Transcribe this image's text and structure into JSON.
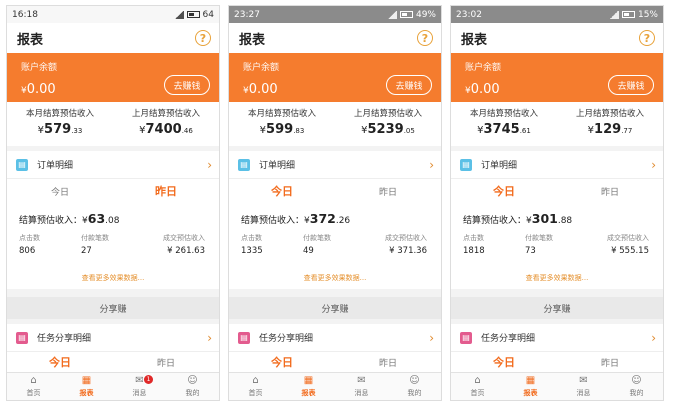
{
  "colors": {
    "accent": "#f57c2e",
    "active_tab": "#f26b1d",
    "help_icon": "#e8a23a"
  },
  "phones": [
    {
      "status": {
        "time": "16:18",
        "right": "64"
      },
      "title": "报表",
      "balance": {
        "label": "账户余额",
        "currency": "¥",
        "amount": "0.00",
        "button": "去赚钱"
      },
      "monthly": [
        {
          "label": "本月结算预估收入",
          "currency": "¥",
          "int": "579",
          "dec": ".33"
        },
        {
          "label": "上月结算预估收入",
          "currency": "¥",
          "int": "7400",
          "dec": ".46"
        }
      ],
      "orders_link": "订单明细",
      "tabs": [
        "今日",
        "昨日"
      ],
      "summary": {
        "label": "结算预估收入：",
        "currency": "¥",
        "int": "63",
        "dec": ".08"
      },
      "stats": [
        {
          "label": "点击数",
          "value": "806"
        },
        {
          "label": "付款笔数",
          "value": "27"
        },
        {
          "label": "成交预估收入",
          "value": "¥ 261.63"
        }
      ],
      "more": "查看更多效果数据...",
      "share_bar": "分享赚",
      "task_link": "任务分享明细",
      "tabs2": [
        "今日",
        "昨日"
      ],
      "nav": [
        {
          "label": "首页",
          "icon": "home-icon"
        },
        {
          "label": "报表",
          "icon": "report-icon"
        },
        {
          "label": "消息",
          "icon": "mail-icon",
          "badge": "1"
        },
        {
          "label": "我的",
          "icon": "user-icon"
        }
      ]
    },
    {
      "status": {
        "time": "23:27",
        "right": "49%"
      },
      "title": "报表",
      "balance": {
        "label": "账户余额",
        "currency": "¥",
        "amount": "0.00",
        "button": "去赚钱"
      },
      "monthly": [
        {
          "label": "本月结算预估收入",
          "currency": "¥",
          "int": "599",
          "dec": ".83"
        },
        {
          "label": "上月结算预估收入",
          "currency": "¥",
          "int": "5239",
          "dec": ".05"
        }
      ],
      "orders_link": "订单明细",
      "tabs": [
        "今日",
        "昨日"
      ],
      "summary": {
        "label": "结算预估收入：",
        "currency": "¥",
        "int": "372",
        "dec": ".26"
      },
      "stats": [
        {
          "label": "点击数",
          "value": "1335"
        },
        {
          "label": "付款笔数",
          "value": "49"
        },
        {
          "label": "成交预估收入",
          "value": "¥ 371.36"
        }
      ],
      "more": "查看更多效果数据...",
      "share_bar": "分享赚",
      "task_link": "任务分享明细",
      "tabs2": [
        "今日",
        "昨日"
      ],
      "nav": [
        {
          "label": "首页",
          "icon": "home-icon"
        },
        {
          "label": "报表",
          "icon": "report-icon"
        },
        {
          "label": "消息",
          "icon": "mail-icon"
        },
        {
          "label": "我的",
          "icon": "user-icon"
        }
      ]
    },
    {
      "status": {
        "time": "23:02",
        "right": "15%"
      },
      "title": "报表",
      "balance": {
        "label": "账户余额",
        "currency": "¥",
        "amount": "0.00",
        "button": "去赚钱"
      },
      "monthly": [
        {
          "label": "本月结算预估收入",
          "currency": "¥",
          "int": "3745",
          "dec": ".61"
        },
        {
          "label": "上月结算预估收入",
          "currency": "¥",
          "int": "129",
          "dec": ".77"
        }
      ],
      "orders_link": "订单明细",
      "tabs": [
        "今日",
        "昨日"
      ],
      "summary": {
        "label": "结算预估收入：",
        "currency": "¥",
        "int": "301",
        "dec": ".88"
      },
      "stats": [
        {
          "label": "点击数",
          "value": "1818"
        },
        {
          "label": "付款笔数",
          "value": "73"
        },
        {
          "label": "成交预估收入",
          "value": "¥ 555.15"
        }
      ],
      "more": "查看更多效果数据...",
      "share_bar": "分享赚",
      "task_link": "任务分享明细",
      "tabs2": [
        "今日",
        "昨日"
      ],
      "nav": [
        {
          "label": "首页",
          "icon": "home-icon"
        },
        {
          "label": "报表",
          "icon": "report-icon"
        },
        {
          "label": "消息",
          "icon": "mail-icon"
        },
        {
          "label": "我的",
          "icon": "user-icon"
        }
      ]
    }
  ]
}
